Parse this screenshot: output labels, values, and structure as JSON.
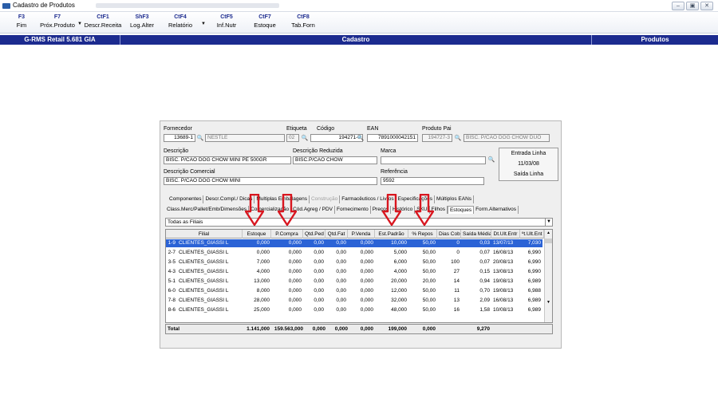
{
  "window": {
    "title": "Cadastro de Produtos"
  },
  "toolbar": {
    "buttons": [
      {
        "key": "F3",
        "label": "Fim"
      },
      {
        "key": "F7",
        "label": "Próx.Produto"
      },
      {
        "key": "CtF1",
        "label": "Descr.Receita"
      },
      {
        "key": "ShF3",
        "label": "Log.Alter"
      },
      {
        "key": "CtF4",
        "label": "Relatório"
      },
      {
        "key": "CtF5",
        "label": "Inf.Nutr"
      },
      {
        "key": "CtF7",
        "label": "Estoque"
      },
      {
        "key": "CtF8",
        "label": "Tab.Forn"
      }
    ]
  },
  "statusbar": {
    "app": "G-RMS Retail 5.681 GIA",
    "section": "Cadastro",
    "module": "Produtos"
  },
  "form": {
    "fornecedor_label": "Fornecedor",
    "fornecedor_code": "13689-1",
    "fornecedor_name": "NESTLE",
    "etiqueta_label": "Etiqueta",
    "etiqueta": "02",
    "codigo_label": "Código",
    "codigo": "194271-9",
    "ean_label": "EAN",
    "ean": "7891000042151",
    "produto_pai_label": "Produto Pai",
    "produto_pai_code": "194727-3",
    "produto_pai_name": "BISC. P/CAO DOG CHOW DUO",
    "descricao_label": "Descrição",
    "descricao": "BISC. P/CAO DOG CHOW MINI     PE 500GR",
    "descricao_reduzida_label": "Descrição Reduzida",
    "descricao_reduzida": "BISC.P/CAO CHOW",
    "marca_label": "Marca",
    "marca": "",
    "descricao_comercial_label": "Descrição Comercial",
    "descricao_comercial": "BISC. P/CAO DOG CHOW MINI",
    "referencia_label": "Referência",
    "referencia": "9592"
  },
  "side": {
    "entrada_label": "Entrada Linha",
    "entrada_date": "11/03/08",
    "saida_label": "Saída Linha"
  },
  "tabs_row1": [
    {
      "label": "Componentes",
      "disabled": false
    },
    {
      "label": "Descr.Compl./ Dicas",
      "disabled": false
    },
    {
      "label": "Multiplas Embalagens",
      "disabled": false
    },
    {
      "label": "Construção",
      "disabled": true
    },
    {
      "label": "Farmacêuticos / Livros",
      "disabled": false
    },
    {
      "label": "Especificações",
      "disabled": false
    },
    {
      "label": "Múltiplos EANs",
      "disabled": false
    }
  ],
  "tabs_row2": [
    {
      "label": "Class.Merc/Pallet/Emb/Dimensões",
      "active": false
    },
    {
      "label": "Comercialização",
      "active": false
    },
    {
      "label": "Cód.Agreg / PDV",
      "active": false
    },
    {
      "label": "Fornecimento",
      "active": false
    },
    {
      "label": "Preços",
      "active": false
    },
    {
      "label": "Histórico",
      "active": false
    },
    {
      "label": "SKU",
      "active": false
    },
    {
      "label": "Filhos",
      "active": false
    },
    {
      "label": "Estoques",
      "active": true
    },
    {
      "label": "Form.Alternativos",
      "active": false
    }
  ],
  "filter": {
    "selected": "Todas as Filiais"
  },
  "table": {
    "columns": [
      "Filial",
      "Estoque",
      "P.Compra",
      "Qtd.Ped",
      "Qtd.Fat",
      "P.Venda",
      "Est.Padrão",
      "% Repos",
      "Dias Cob",
      "Saída Média",
      "Dt.Ult.Entr",
      "ºt.Ult.Ent"
    ],
    "rows": [
      [
        "1-9",
        "CLIENTES_GIASSI L",
        "0,000",
        "0,000",
        "0,00",
        "0,00",
        "0,000",
        "10,000",
        "50,00",
        "0",
        "0,03",
        "13/07/13",
        "7,030"
      ],
      [
        "2-7",
        "CLIENTES_GIASSI L",
        "0,000",
        "0,000",
        "0,00",
        "0,00",
        "0,000",
        "5,000",
        "50,00",
        "0",
        "0,07",
        "16/08/13",
        "6,990"
      ],
      [
        "3-5",
        "CLIENTES_GIASSI L",
        "7,000",
        "0,000",
        "0,00",
        "0,00",
        "0,000",
        "6,000",
        "50,00",
        "100",
        "0,07",
        "20/08/13",
        "6,990"
      ],
      [
        "4-3",
        "CLIENTES_GIASSI L",
        "4,000",
        "0,000",
        "0,00",
        "0,00",
        "0,000",
        "4,000",
        "50,00",
        "27",
        "0,15",
        "13/08/13",
        "6,990"
      ],
      [
        "5-1",
        "CLIENTES_GIASSI L",
        "13,000",
        "0,000",
        "0,00",
        "0,00",
        "0,000",
        "20,000",
        "20,00",
        "14",
        "0,94",
        "19/08/13",
        "6,989"
      ],
      [
        "6-0",
        "CLIENTES_GIASSI L",
        "8,000",
        "0,000",
        "0,00",
        "0,00",
        "0,000",
        "12,000",
        "50,00",
        "11",
        "0,70",
        "19/08/13",
        "6,988"
      ],
      [
        "7-8",
        "CLIENTES_GIASSI L",
        "28,000",
        "0,000",
        "0,00",
        "0,00",
        "0,000",
        "32,000",
        "50,00",
        "13",
        "2,09",
        "16/08/13",
        "6,989"
      ],
      [
        "8-6",
        "CLIENTES_GIASSI L",
        "25,000",
        "0,000",
        "0,00",
        "0,00",
        "0,000",
        "48,000",
        "50,00",
        "16",
        "1,58",
        "10/08/13",
        "6,989"
      ]
    ],
    "totals": {
      "label": "Total",
      "estoque": "1.141,000",
      "p_compra": "159.563,000",
      "qtd_ped": "0,000",
      "qtd_fat": "0,000",
      "p_venda": "0,000",
      "est_padrao": "199,000",
      "repos": "0,000",
      "saida_media": "9,270"
    }
  },
  "colors": {
    "brand_bar": "#1c2b8f",
    "selection": "#2b63d6",
    "annotation_arrow": "#d8161f"
  }
}
